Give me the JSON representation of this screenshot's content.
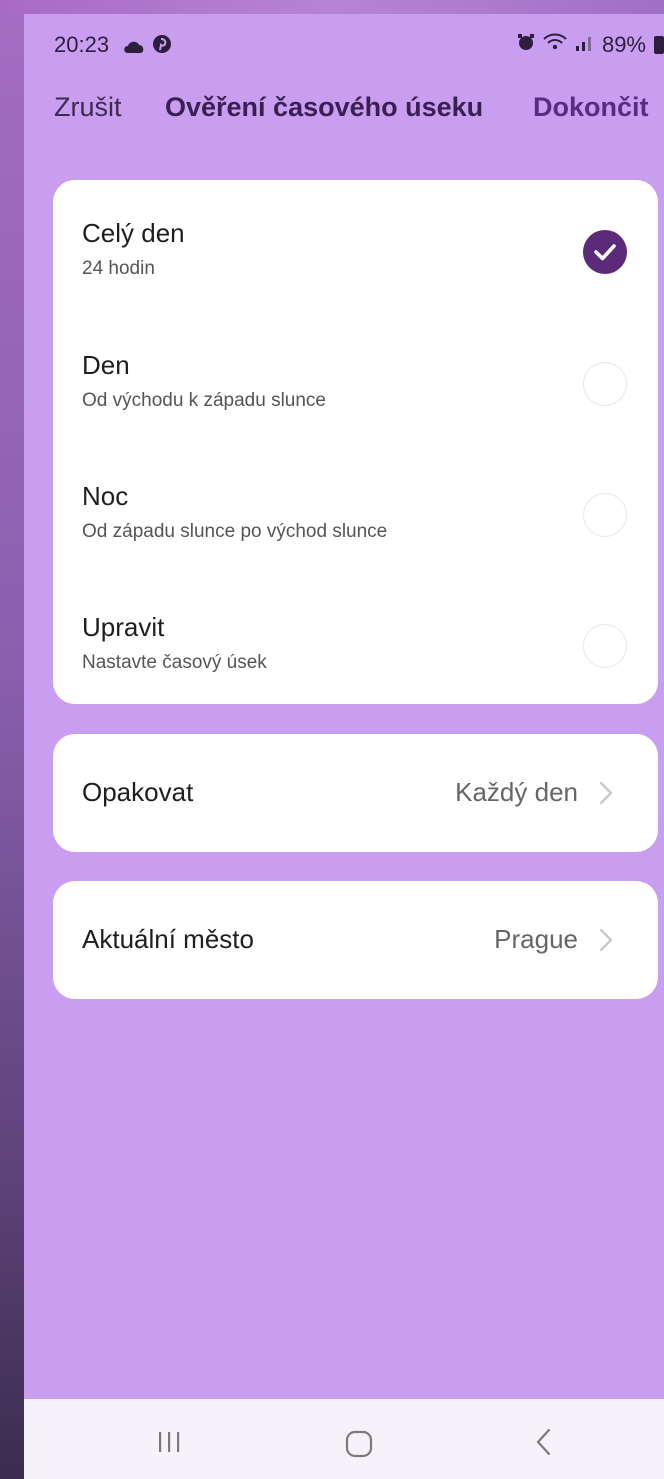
{
  "status_bar": {
    "time": "20:23",
    "cloud_icon": "cloud-icon",
    "pinterest_icon": "pinterest-icon",
    "alarm_icon": "alarm-icon",
    "wifi_icon": "wifi-icon",
    "signal_icon": "signal-icon",
    "battery_percent": "89%"
  },
  "header": {
    "cancel_label": "Zrušit",
    "title": "Ověření časového úseku",
    "done_label": "Dokončit"
  },
  "time_options": [
    {
      "title": "Celý den",
      "subtitle": "24 hodin",
      "selected": true
    },
    {
      "title": "Den",
      "subtitle": "Od východu k západu slunce",
      "selected": false
    },
    {
      "title": "Noc",
      "subtitle": "Od západu slunce po východ slunce",
      "selected": false
    },
    {
      "title": "Upravit",
      "subtitle": "Nastavte časový úsek",
      "selected": false
    }
  ],
  "repeat": {
    "label": "Opakovat",
    "value": "Každý den"
  },
  "city": {
    "label": "Aktuální město",
    "value": "Prague"
  },
  "nav": {
    "recent_icon": "recent-apps-icon",
    "home_icon": "home-icon",
    "back_icon": "back-icon"
  },
  "colors": {
    "background": "#c99ef0",
    "accent": "#5b2b7a",
    "card": "#ffffff",
    "nav_bar": "#f7f2f9"
  }
}
